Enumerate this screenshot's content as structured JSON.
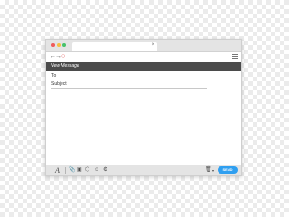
{
  "window": {
    "tab_close_glyph": "×",
    "traffic_lights": [
      "#ef5b5b",
      "#f5c043",
      "#47c26a"
    ]
  },
  "navbar": {
    "back_glyph": "←",
    "forward_glyph": "→",
    "reload_glyph": "○"
  },
  "compose": {
    "title": "New Message",
    "to_label": "To",
    "subject_label": "Subject",
    "body": ""
  },
  "toolbar": {
    "font_glyph": "A",
    "attach_glyph": "📎",
    "image_glyph": "▣",
    "link_glyph": "⬡",
    "emoji_glyph": "☺",
    "more_glyph": "⚙",
    "trash_glyph": "🗑",
    "dropdown_glyph": "▾",
    "send_label": "SEND",
    "send_color": "#2f9ff0"
  }
}
